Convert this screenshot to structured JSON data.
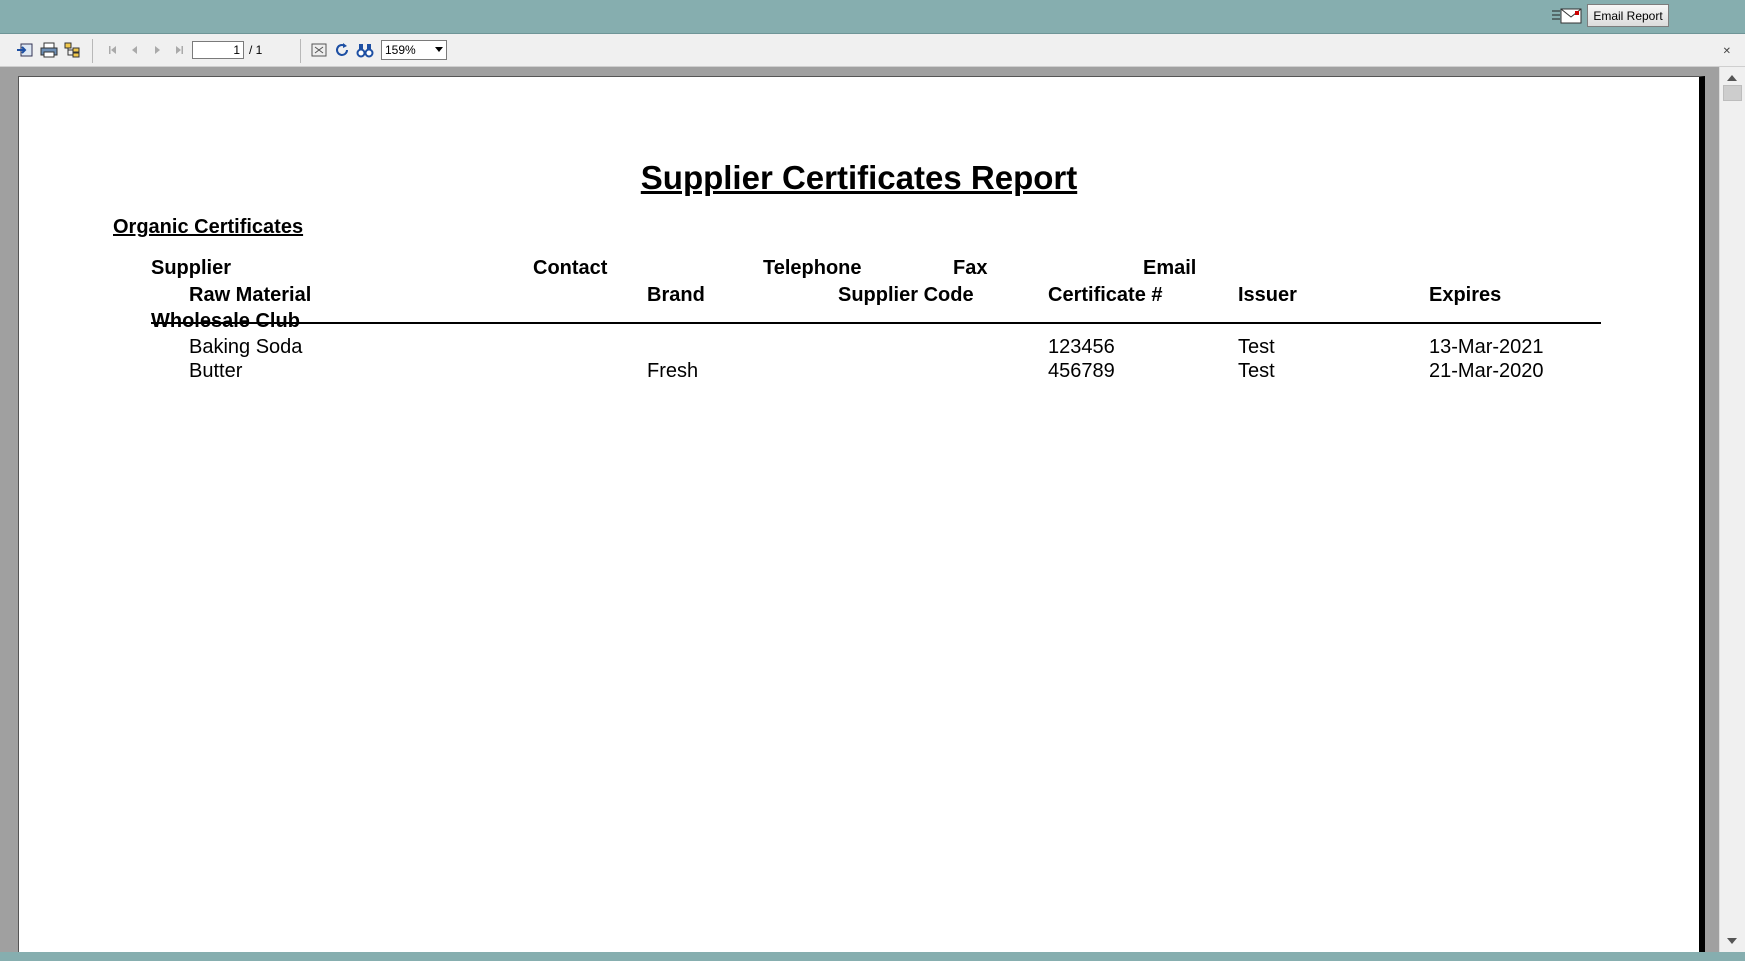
{
  "topbar": {
    "email_button": "Email Report"
  },
  "toolbar": {
    "page_current": "1",
    "page_total": "/ 1",
    "zoom": "159%"
  },
  "report": {
    "title": "Supplier Certificates Report",
    "section": "Organic Certificates",
    "headers_row1": {
      "supplier": "Supplier",
      "contact": "Contact",
      "telephone": "Telephone",
      "fax": "Fax",
      "email": "Email"
    },
    "headers_row2": {
      "raw_material": "Raw Material",
      "brand": "Brand",
      "supplier_code": "Supplier Code",
      "certificate": "Certificate #",
      "issuer": "Issuer",
      "expires": "Expires"
    },
    "group": "Wholesale Club",
    "rows": [
      {
        "raw_material": "Baking Soda",
        "brand": "",
        "certificate": "123456",
        "issuer": "Test",
        "expires": "13-Mar-2021"
      },
      {
        "raw_material": "Butter",
        "brand": "Fresh",
        "certificate": "456789",
        "issuer": "Test",
        "expires": "21-Mar-2020"
      }
    ]
  }
}
